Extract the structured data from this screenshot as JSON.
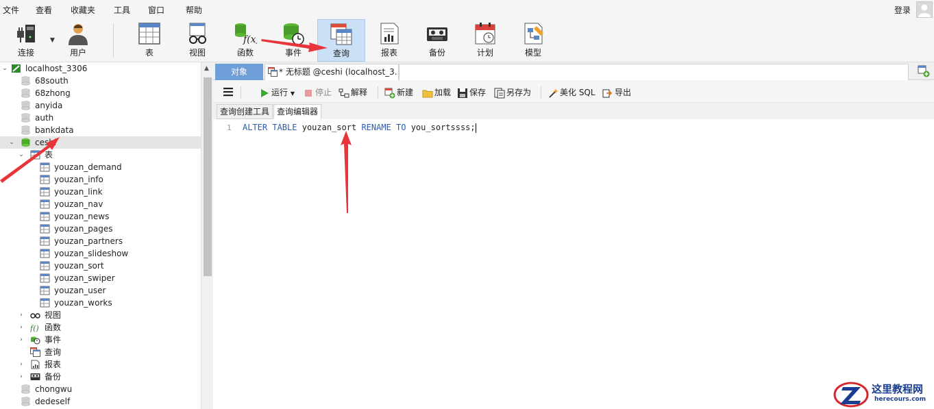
{
  "menubar": {
    "items": [
      "文件",
      "查看",
      "收藏夹",
      "工具",
      "窗口",
      "帮助"
    ],
    "login": "登录"
  },
  "toolbar": {
    "items": [
      {
        "label": "连接",
        "icon": "connection-plug-icon"
      },
      {
        "label": "用户",
        "icon": "user-icon"
      },
      {
        "label": "表",
        "icon": "table-icon"
      },
      {
        "label": "视图",
        "icon": "view-glasses-icon"
      },
      {
        "label": "函数",
        "icon": "function-icon"
      },
      {
        "label": "事件",
        "icon": "event-clock-icon"
      },
      {
        "label": "查询",
        "icon": "query-icon",
        "active": true
      },
      {
        "label": "报表",
        "icon": "report-icon"
      },
      {
        "label": "备份",
        "icon": "backup-icon"
      },
      {
        "label": "计划",
        "icon": "schedule-calendar-icon"
      },
      {
        "label": "模型",
        "icon": "model-icon"
      }
    ]
  },
  "tree": {
    "connection": "localhost_3306",
    "databases_before": [
      "68south",
      "68zhong",
      "anyida",
      "auth",
      "bankdata"
    ],
    "selected_db": "ceshi",
    "tables_group": "表",
    "tables": [
      "youzan_demand",
      "youzan_info",
      "youzan_link",
      "youzan_nav",
      "youzan_news",
      "youzan_pages",
      "youzan_partners",
      "youzan_slideshow",
      "youzan_sort",
      "youzan_swiper",
      "youzan_user",
      "youzan_works"
    ],
    "groups": [
      {
        "label": "视图",
        "icon": "view-glasses-icon",
        "expandable": true
      },
      {
        "label": "函数",
        "icon": "function-icon",
        "expandable": true
      },
      {
        "label": "事件",
        "icon": "event-clock-icon",
        "expandable": true
      },
      {
        "label": "查询",
        "icon": "query-icon",
        "expandable": false
      },
      {
        "label": "报表",
        "icon": "report-icon",
        "expandable": true
      },
      {
        "label": "备份",
        "icon": "backup-icon",
        "expandable": true
      }
    ],
    "databases_after": [
      "chongwu",
      "dedeself"
    ]
  },
  "tabs": {
    "object": "对象",
    "query": "* 无标题 @ceshi (localhost_3..."
  },
  "query_toolbar": {
    "run": "运行",
    "stop": "停止",
    "explain": "解释",
    "new": "新建",
    "load": "加载",
    "save": "保存",
    "save_as": "另存为",
    "beautify": "美化 SQL",
    "export": "导出"
  },
  "subtabs": {
    "builder": "查询创建工具",
    "editor": "查询编辑器"
  },
  "editor": {
    "line_number": "1",
    "kw1": "ALTER TABLE",
    "id1": "youzan_sort",
    "kw2": "RENAME TO",
    "id2": "you_sortssss;"
  },
  "watermark": {
    "title": "这里教程网",
    "url": "herecours.com"
  },
  "colors": {
    "accent_tab": "#6f9fd8",
    "active_tool": "#c9e0f7",
    "keyword": "#2a5db0",
    "annotation_arrow": "#e8353b",
    "db_green": "#5ab533"
  }
}
